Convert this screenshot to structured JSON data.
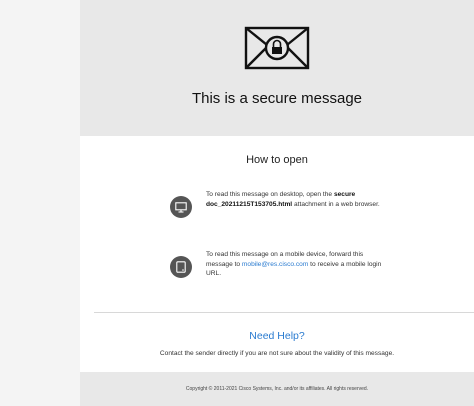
{
  "header": {
    "title": "This is a secure message",
    "icon": "locked-envelope-icon"
  },
  "how_to": {
    "heading": "How to open",
    "desktop": {
      "icon": "monitor-icon",
      "text_before": "To read this message on desktop, open the ",
      "filename": "secure doc_20211215T153705.html",
      "text_after": " attachment in a web browser."
    },
    "mobile": {
      "icon": "tablet-icon",
      "text_before": "To read this message on a mobile device, forward this message to ",
      "email": "mobile@res.cisco.com",
      "text_after": " to receive a mobile login URL."
    }
  },
  "help": {
    "title": "Need Help?",
    "text": "Contact the sender directly if you are not sure about the validity of this message."
  },
  "footer": {
    "copyright": "Copyright © 2011-2021 Cisco Systems, Inc. and/or its affiliates. All rights reserved."
  },
  "colors": {
    "accent_link": "#2a7bd0",
    "header_bg": "#e8e8e8",
    "icon_bg": "#555555"
  }
}
